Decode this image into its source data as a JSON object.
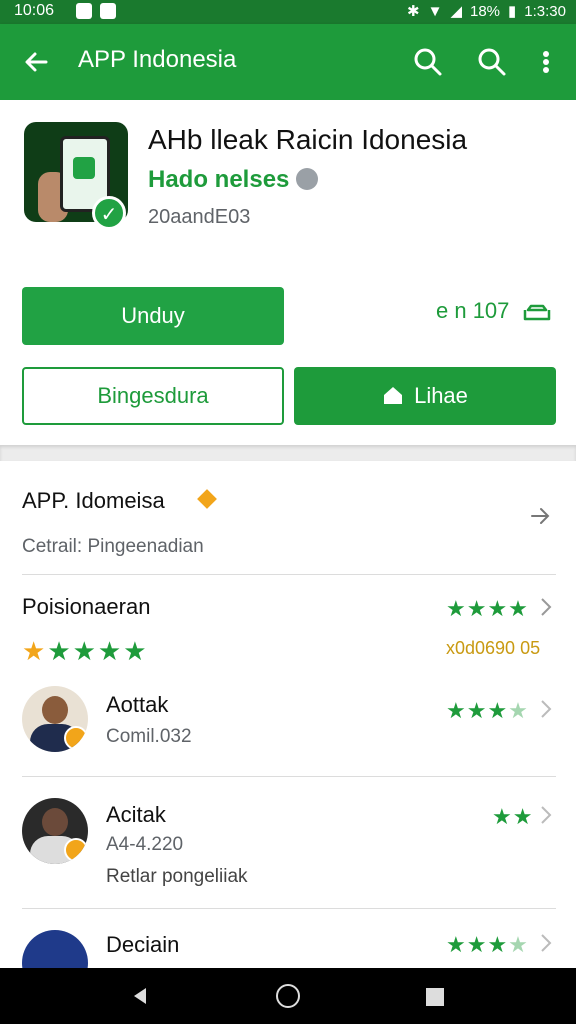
{
  "status_bar": {
    "time": "10:06",
    "battery": "18%",
    "clock_right": "1:3:30"
  },
  "toolbar": {
    "title": "APP Indonesia"
  },
  "app": {
    "name": "AHb lleak Raicin Idonesia",
    "developer": "Hado nelses",
    "meta": "20aandE03"
  },
  "actions": {
    "download_label": "Unduy",
    "size_text": "e n 107",
    "secondary_label": "Bingesdura",
    "primary_label": "Lihae"
  },
  "sections": {
    "app_info": {
      "title": "APP. Idomeisa",
      "subtitle": "Cetrail: Pingeenadian"
    },
    "ratings": {
      "title": "Poisionaeran",
      "big_stars": "★★★★★",
      "code": "x0d0690 05",
      "right_stars": "★★★★"
    }
  },
  "reviews": [
    {
      "name": "Aottak",
      "subtitle": "Comil.032",
      "stars": "★★★",
      "dim_stars": "★"
    },
    {
      "name": "Acitak",
      "subtitle": "A4-4.220",
      "extra": "Retlar pongeliiak",
      "stars": "★★",
      "dim_stars": ""
    },
    {
      "name": "Deciain",
      "subtitle": "",
      "stars": "★★★",
      "dim_stars": "★"
    }
  ],
  "colors": {
    "toolbar": "#1e9b3b",
    "status_bar": "#1a7a2e",
    "accent": "#21a244",
    "gold": "#f2a51a"
  }
}
